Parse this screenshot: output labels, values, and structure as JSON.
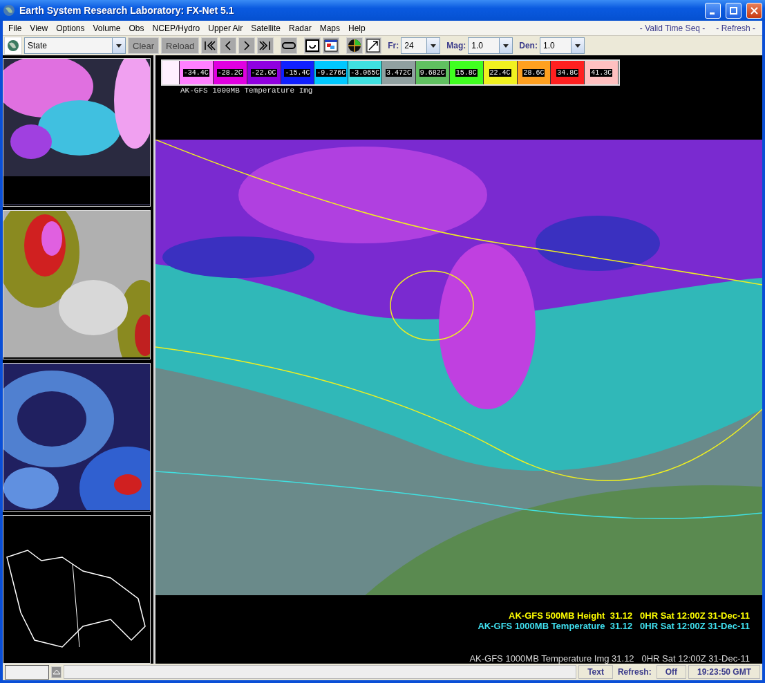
{
  "window": {
    "title": "Earth System Research Laboratory: FX-Net 5.1"
  },
  "menu": [
    "File",
    "View",
    "Options",
    "Volume",
    "Obs",
    "NCEP/Hydro",
    "Upper Air",
    "Satellite",
    "Radar",
    "Maps",
    "Help"
  ],
  "menu_right": [
    "- Valid Time Seq -",
    "- Refresh -"
  ],
  "toolbar": {
    "scale": "State",
    "buttons": [
      "Clear",
      "Reload"
    ],
    "fields": [
      {
        "label": "Fr:",
        "value": "24"
      },
      {
        "label": "Mag:",
        "value": "1.0"
      },
      {
        "label": "Den:",
        "value": "1.0"
      }
    ]
  },
  "thumbnails": [
    {
      "kind": "picture"
    },
    {
      "kind": "picture"
    },
    {
      "kind": "picture"
    },
    {
      "kind": "picture"
    }
  ],
  "colorbar": {
    "title": "AK-GFS 1000MB Temperature Img",
    "ticks": [
      {
        "label": "-34.4C",
        "color": "#ff80ff"
      },
      {
        "label": "-28.2C",
        "color": "#e000e0"
      },
      {
        "label": "-22.0C",
        "color": "#9000e0"
      },
      {
        "label": "-15.4C",
        "color": "#1020ff"
      },
      {
        "label": "-9.276C",
        "color": "#00c8ff"
      },
      {
        "label": "-3.065C",
        "color": "#40e0e0"
      },
      {
        "label": "3.472C",
        "color": "#90a0a0"
      },
      {
        "label": "9.682C",
        "color": "#60c060"
      },
      {
        "label": "15.8C",
        "color": "#40ff20"
      },
      {
        "label": "22.4C",
        "color": "#f0f020"
      },
      {
        "label": "28.6C",
        "color": "#ffa020"
      },
      {
        "label": "34.8C",
        "color": "#ff2020"
      },
      {
        "label": "41.3C",
        "color": "#ffc0c0"
      }
    ]
  },
  "map": {
    "kind": "picture"
  },
  "legend": [
    {
      "text": "AK-GFS 500MB Height  31.12   0HR Sat 12:00Z 31-Dec-11",
      "color": "#ffff00"
    },
    {
      "text": "AK-GFS 1000MB Temperature  31.12   0HR Sat 12:00Z 31-Dec-11",
      "color": "#40e0f0"
    },
    {
      "text": "AK-GFS 1000MB Temperature Img 31.12   0HR Sat 12:00Z 31-Dec-11",
      "color": "#d8d8d8"
    }
  ],
  "status_bar": {
    "text_button": "Text",
    "refresh_label": "Refresh:",
    "refresh_value": "Off",
    "clock": "19:23:50 GMT"
  }
}
